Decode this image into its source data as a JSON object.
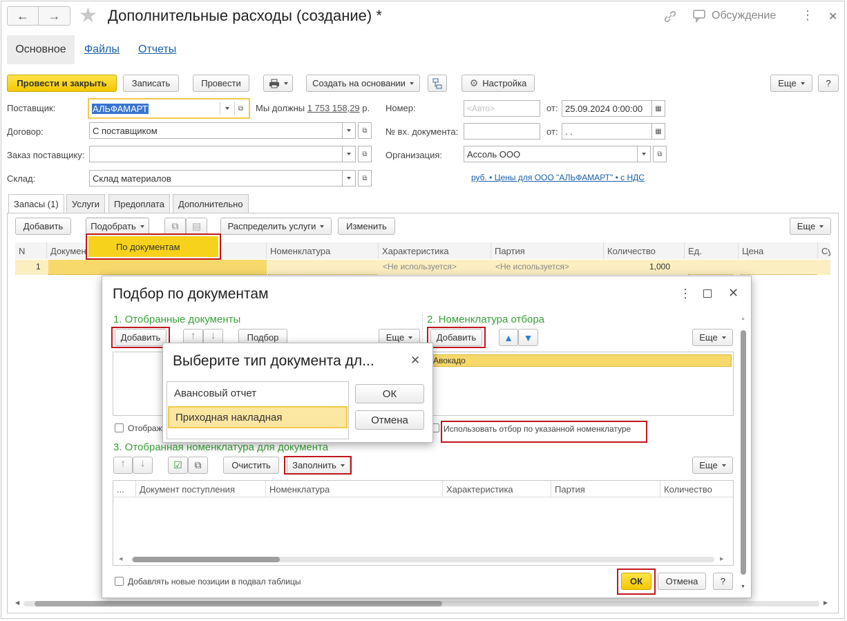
{
  "window": {
    "title": "Дополнительные расходы (создание) *",
    "discussion": "Обсуждение"
  },
  "nav_tabs": [
    "Основное",
    "Файлы",
    "Отчеты"
  ],
  "toolbar": {
    "post_close": "Провести и закрыть",
    "save": "Записать",
    "post": "Провести",
    "create_based": "Создать на основании",
    "settings": "Настройка",
    "more": "Еще",
    "help": "?"
  },
  "form": {
    "supplier_label": "Поставщик:",
    "supplier_value": "АЛЬФАМАРТ",
    "we_owe_label": "Мы должны",
    "we_owe_amount": "1 753 158,29",
    "we_owe_currency": "р.",
    "number_label": "Номер:",
    "number_placeholder": "<Авто>",
    "from_label": "от:",
    "date_value": "25.09.2024  0:00:00",
    "contract_label": "Договор:",
    "contract_value": "С поставщиком",
    "incoming_doc_label": "№ вх. документа:",
    "from_label2": "от:",
    "incoming_date_value": " .  .",
    "order_label": "Заказ поставщику:",
    "org_label": "Организация:",
    "org_value": "Ассоль ООО",
    "warehouse_label": "Склад:",
    "warehouse_value": "Склад материалов",
    "price_link": "руб. • Цены для ООО \"АЛЬФАМАРТ\" • с НДС"
  },
  "section_tabs": [
    "Запасы (1)",
    "Услуги",
    "Предоплата",
    "Дополнительно"
  ],
  "table_toolbar": {
    "add": "Добавить",
    "pick": "Подобрать",
    "distribute": "Распределить услуги",
    "change": "Изменить",
    "more": "Еще",
    "dropdown_item": "По документам"
  },
  "table": {
    "columns": [
      "N",
      "Документ",
      "Номенклатура",
      "Характеристика",
      "Партия",
      "Количество",
      "Ед.",
      "Цена",
      "Сумма"
    ],
    "row": {
      "n": "1",
      "characteristic": "<Не используется>",
      "batch": "<Не используется>",
      "qty": "1,000"
    }
  },
  "dialog": {
    "title": "Подбор по документам",
    "section1": "1. Отобранные документы",
    "section2": "2. Номенклатура отбора",
    "section3": "3. Отобранная номенклатура для документа",
    "add": "Добавить",
    "pick": "Подбор",
    "more": "Еще",
    "add2": "Добавить",
    "more2": "Еще",
    "nomenclature_item": "Авокадо",
    "show_checkbox": "Отображ",
    "use_filter_checkbox": "Использовать отбор по указанной номенклатуре",
    "clear": "Очистить",
    "fill": "Заполнить",
    "more3": "Еще",
    "columns": [
      "...",
      "Документ поступления",
      "Номенклатура",
      "Характеристика",
      "Партия",
      "Количество"
    ],
    "add_new_checkbox": "Добавлять новые позиции в подвал таблицы",
    "ok": "ОК",
    "cancel": "Отмена",
    "help": "?"
  },
  "popup": {
    "title": "Выберите тип документа дл...",
    "items": [
      "Авансовый отчет",
      "Приходная накладная"
    ],
    "ok": "ОК",
    "cancel": "Отмена"
  },
  "colors": {
    "accent_yellow": "#f6d21c",
    "highlight_red": "#c0161c",
    "section_green": "#3a9f3a",
    "link_blue": "#1a5fa8"
  }
}
